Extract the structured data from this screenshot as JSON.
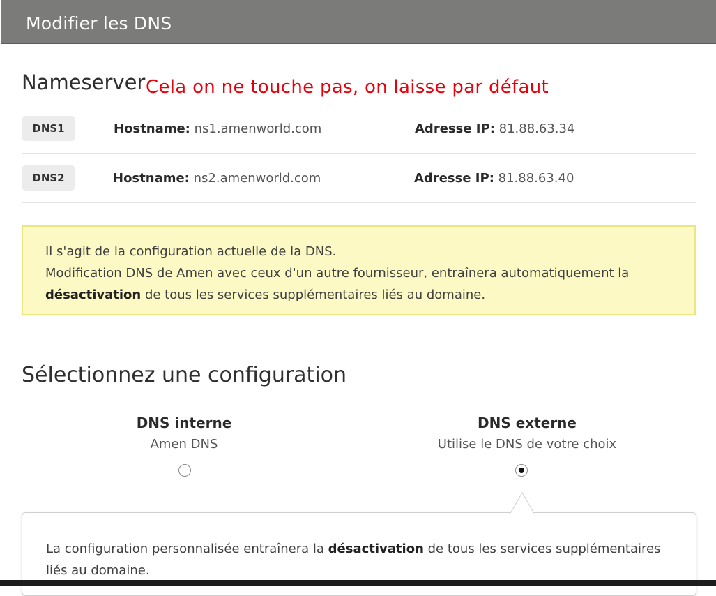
{
  "dialog": {
    "title": "Modifier les DNS"
  },
  "nameserver": {
    "heading": "Nameserver",
    "annotation": "Cela on ne touche pas, on laisse par défaut",
    "rows": [
      {
        "badge": "DNS1",
        "hostname_label": "Hostname:",
        "hostname": "ns1.amenworld.com",
        "ip_label": "Adresse IP:",
        "ip": "81.88.63.34"
      },
      {
        "badge": "DNS2",
        "hostname_label": "Hostname:",
        "hostname": "ns2.amenworld.com",
        "ip_label": "Adresse IP:",
        "ip": "81.88.63.40"
      }
    ]
  },
  "notice": {
    "line1": "Il s'agit de la configuration actuelle de la DNS.",
    "line2": "Modification DNS de Amen avec ceux d'un autre fournisseur, entraînera automatiquement la",
    "line3_bold": "désactivation",
    "line3_rest": " de tous les services supplémentaires liés au domaine."
  },
  "config": {
    "heading": "Sélectionnez une configuration",
    "options": [
      {
        "title": "DNS interne",
        "subtitle": "Amen DNS",
        "selected": false
      },
      {
        "title": "DNS externe",
        "subtitle": "Utilise le DNS de votre choix",
        "selected": true
      }
    ]
  },
  "popover": {
    "text_before": "La configuration personnalisée entraînera la ",
    "text_bold": "désactivation",
    "text_after": " de tous les services supplémentaires liés au domaine."
  },
  "colors": {
    "titlebar": "#7b7b79",
    "annotation": "#e8000b",
    "notice_bg": "#fcf9c4",
    "notice_border": "#ece680"
  }
}
